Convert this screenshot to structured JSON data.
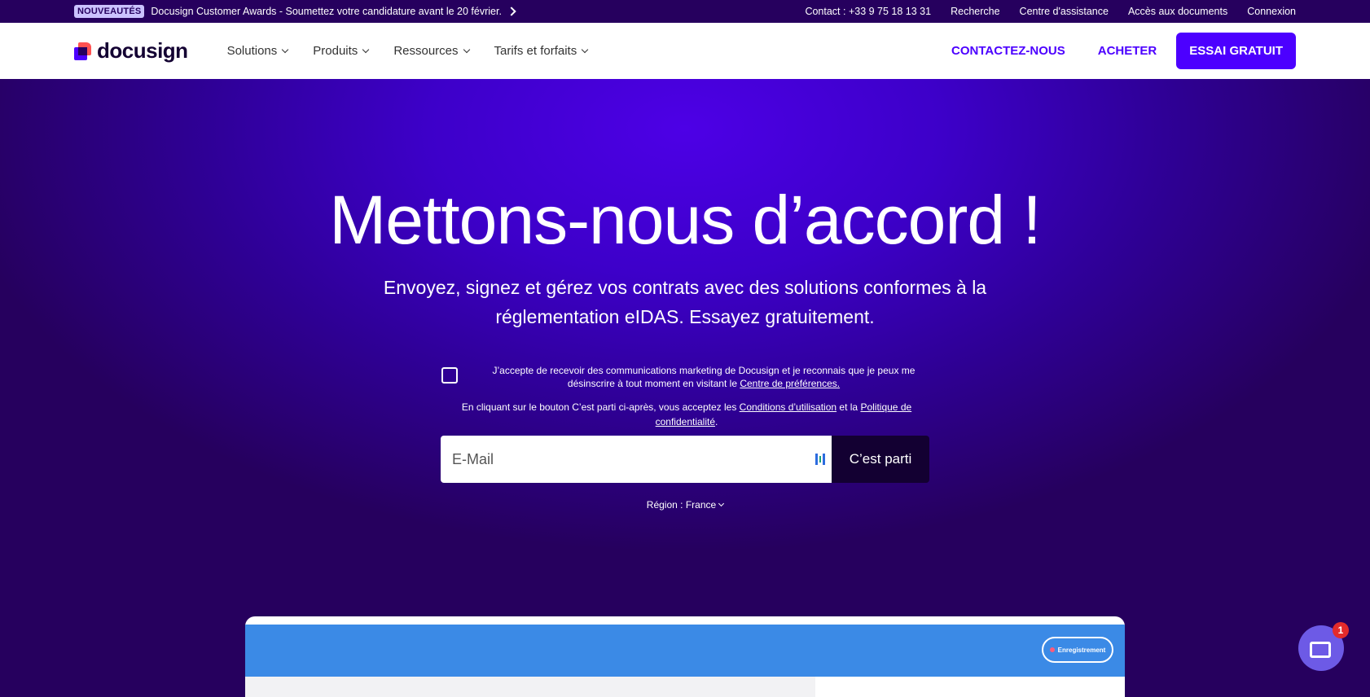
{
  "topbar": {
    "badge": "NOUVEAUTÉS",
    "announcement": "Docusign Customer Awards - Soumettez votre candidature avant le 20 février.",
    "links": [
      "Contact : +33 9 75 18 13 31",
      "Recherche",
      "Centre d'assistance",
      "Accès aux documents",
      "Connexion"
    ]
  },
  "nav": {
    "logo_text": "docusign",
    "menu": [
      "Solutions",
      "Produits",
      "Ressources",
      "Tarifs et forfaits"
    ],
    "contact": "CONTACTEZ-NOUS",
    "buy": "ACHETER",
    "trial": "ESSAI GRATUIT"
  },
  "hero": {
    "title": "Mettons-nous d’accord !",
    "subtitle": "Envoyez, signez et gérez vos contrats avec des solutions conformes à la réglementation eIDAS. Essayez gratuitement.",
    "consent_text": "J’accepte de recevoir des communications marketing de Docusign et je reconnais que je peux me désinscrire à tout moment en visitant le",
    "consent_link": "Centre de préférences.",
    "legal_prefix": "En cliquant sur le bouton C’est parti ci-après, vous acceptez les",
    "legal_terms": "Conditions d’utilisation",
    "legal_and": "et la",
    "legal_privacy": "Politique de confidentialité",
    "email_placeholder": "E-Mail",
    "go_button": "C’est parti",
    "region": "Région : France"
  },
  "preview": {
    "recording_label": "Enregistrement"
  },
  "chat": {
    "badge_count": "1"
  },
  "colors": {
    "brand_purple": "#4c00ff",
    "deep_purple": "#26005e",
    "logo_red": "#ff5252",
    "preview_blue": "#3b8ae6"
  }
}
